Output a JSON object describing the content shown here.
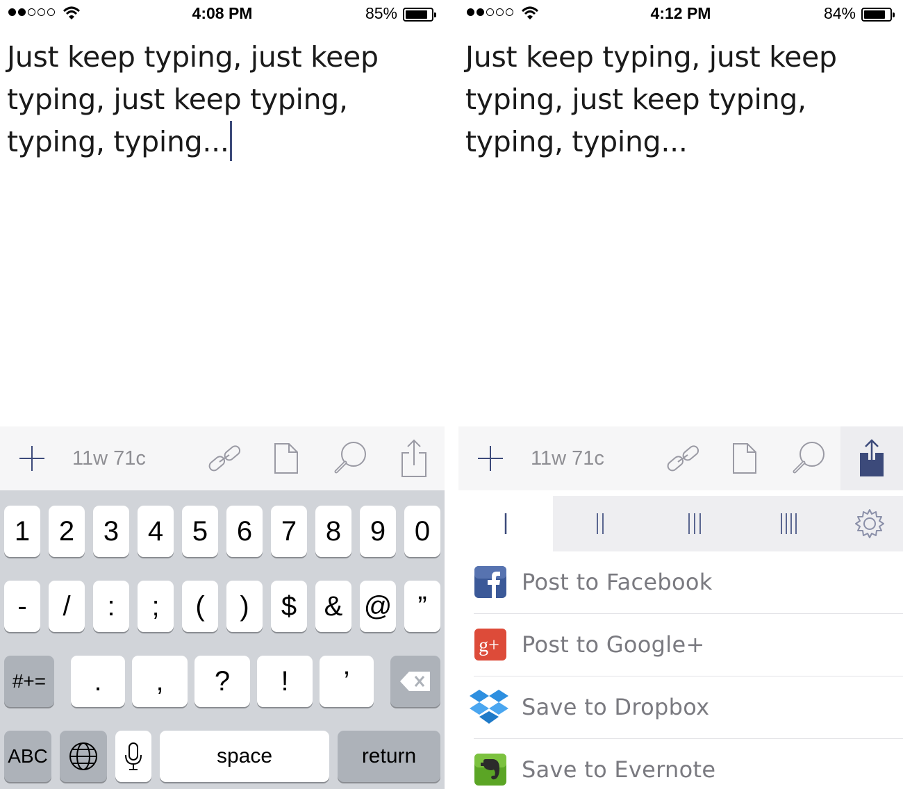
{
  "left": {
    "status": {
      "time": "4:08 PM",
      "battery": "85%",
      "battery_level": 0.85
    },
    "editor_text": "Just keep typing, just keep typing, just keep typing, typing, typing...",
    "toolbar": {
      "counter": "11w 71c"
    },
    "keyboard": {
      "row1": [
        "1",
        "2",
        "3",
        "4",
        "5",
        "6",
        "7",
        "8",
        "9",
        "0"
      ],
      "row2": [
        "-",
        "/",
        ":",
        ";",
        "(",
        ")",
        "$",
        "&",
        "@",
        "”"
      ],
      "row3_toggle": "#+=",
      "row3": [
        ".",
        ",",
        "?",
        "!",
        "’"
      ],
      "abc": "ABC",
      "space": "space",
      "return": "return"
    }
  },
  "right": {
    "status": {
      "time": "4:12 PM",
      "battery": "84%",
      "battery_level": 0.84
    },
    "editor_text": "Just keep typing, just keep typing, just keep typing, typing, typing...",
    "toolbar": {
      "counter": "11w 71c"
    },
    "share_actions": [
      {
        "label": "Post to Facebook",
        "icon": "facebook-icon",
        "color": "#3b5998"
      },
      {
        "label": "Post to Google+",
        "icon": "google-plus-icon",
        "color": "#dd4b39"
      },
      {
        "label": "Save to Dropbox",
        "icon": "dropbox-icon",
        "color": "#2d8fe0"
      },
      {
        "label": "Save to Evernote",
        "icon": "evernote-icon",
        "color": "#5ba525"
      }
    ]
  },
  "colors": {
    "accent": "#3c4a7a",
    "toolbar_bg": "#f6f6f7",
    "keyboard_bg": "#d1d4d9",
    "muted_text": "#8e8e93"
  }
}
